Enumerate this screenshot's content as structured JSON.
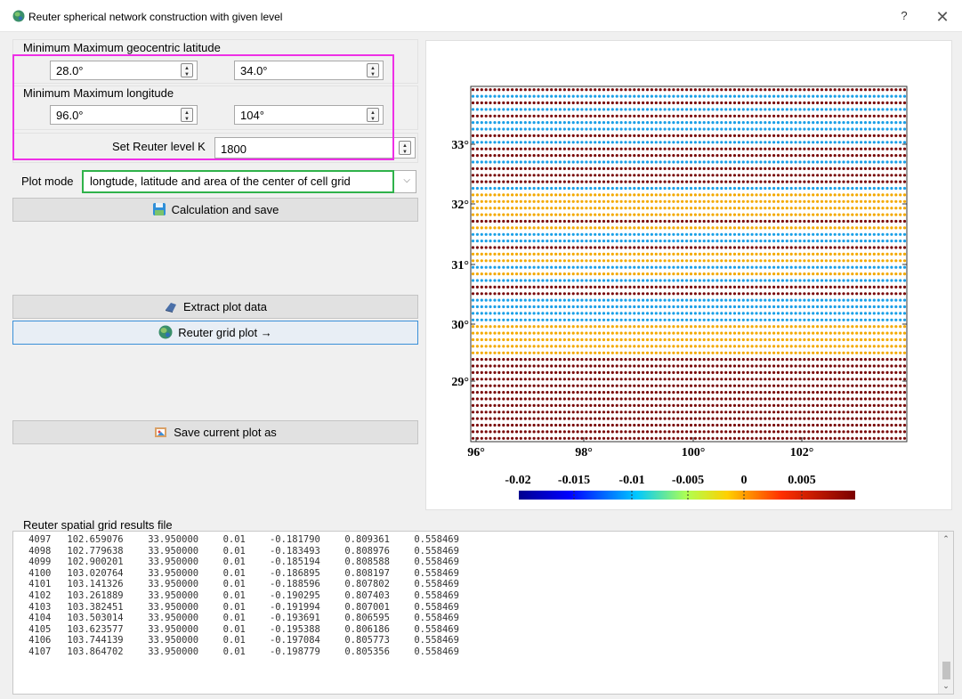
{
  "window": {
    "title": "Reuter spherical network construction with given level",
    "help": "?",
    "close": "✕"
  },
  "latitude": {
    "label": "Minimum Maximum geocentric latitude",
    "min": "28.0°",
    "max": "34.0°"
  },
  "longitude": {
    "label": "Minimum Maximum longitude",
    "min": "96.0°",
    "max": "104°"
  },
  "level": {
    "label": "Set Reuter level K",
    "value": "1800"
  },
  "plot_mode": {
    "label": "Plot mode",
    "value": "longtude, latitude and area of the center of cell grid"
  },
  "buttons": {
    "calc": "Calculation and save",
    "extract": "Extract plot data",
    "grid_plot": "Reuter grid plot →",
    "save_plot": "Save current plot as"
  },
  "results": {
    "label": "Reuter spatial grid results file",
    "rows": [
      [
        "4097",
        "102.659076",
        "33.950000",
        "0.01",
        "-0.181790",
        "0.809361",
        "0.558469"
      ],
      [
        "4098",
        "102.779638",
        "33.950000",
        "0.01",
        "-0.183493",
        "0.808976",
        "0.558469"
      ],
      [
        "4099",
        "102.900201",
        "33.950000",
        "0.01",
        "-0.185194",
        "0.808588",
        "0.558469"
      ],
      [
        "4100",
        "103.020764",
        "33.950000",
        "0.01",
        "-0.186895",
        "0.808197",
        "0.558469"
      ],
      [
        "4101",
        "103.141326",
        "33.950000",
        "0.01",
        "-0.188596",
        "0.807802",
        "0.558469"
      ],
      [
        "4102",
        "103.261889",
        "33.950000",
        "0.01",
        "-0.190295",
        "0.807403",
        "0.558469"
      ],
      [
        "4103",
        "103.382451",
        "33.950000",
        "0.01",
        "-0.191994",
        "0.807001",
        "0.558469"
      ],
      [
        "4104",
        "103.503014",
        "33.950000",
        "0.01",
        "-0.193691",
        "0.806595",
        "0.558469"
      ],
      [
        "4105",
        "103.623577",
        "33.950000",
        "0.01",
        "-0.195388",
        "0.806186",
        "0.558469"
      ],
      [
        "4106",
        "103.744139",
        "33.950000",
        "0.01",
        "-0.197084",
        "0.805773",
        "0.558469"
      ],
      [
        "4107",
        "103.864702",
        "33.950000",
        "0.01",
        "-0.198779",
        "0.805356",
        "0.558469"
      ]
    ]
  },
  "plot": {
    "x_ticks": [
      "96°",
      "98°",
      "100°",
      "102°"
    ],
    "y_ticks": [
      "33°",
      "32°",
      "31°",
      "30°",
      "29°"
    ],
    "colorbar_ticks": [
      "-0.02",
      "-0.015",
      "-0.01",
      "-0.005",
      "0",
      "0.005"
    ],
    "band_colors": [
      "#7a0a0a",
      "#1a9fe8",
      "#7a0a0a",
      "#1a9fe8",
      "#7a0a0a",
      "#1a9fe8",
      "#1a9fe8",
      "#7a0a0a",
      "#1a9fe8",
      "#7a0a0a",
      "#7a0a0a",
      "#1a9fe8",
      "#7a0a0a",
      "#7a0a0a",
      "#7a0a0a",
      "#1a9fe8",
      "#f4a900",
      "#f4a900",
      "#f4a900",
      "#f4a900",
      "#7a0a0a",
      "#f4a900",
      "#1a9fe8",
      "#1a9fe8",
      "#7a0a0a",
      "#f4a900",
      "#f4a900",
      "#1a9fe8",
      "#f4a900",
      "#1a9fe8",
      "#7a0a0a",
      "#7a0a0a",
      "#1a9fe8",
      "#1a9fe8",
      "#1a9fe8",
      "#1a9fe8",
      "#f4a900",
      "#f4a900",
      "#f4a900",
      "#f4a900",
      "#f4a900",
      "#7a0a0a",
      "#7a0a0a",
      "#7a0a0a",
      "#7a0a0a",
      "#7a0a0a",
      "#7a0a0a",
      "#7a0a0a",
      "#7a0a0a",
      "#7a0a0a",
      "#7a0a0a",
      "#7a0a0a",
      "#7a0a0a",
      "#7a0a0a"
    ]
  }
}
